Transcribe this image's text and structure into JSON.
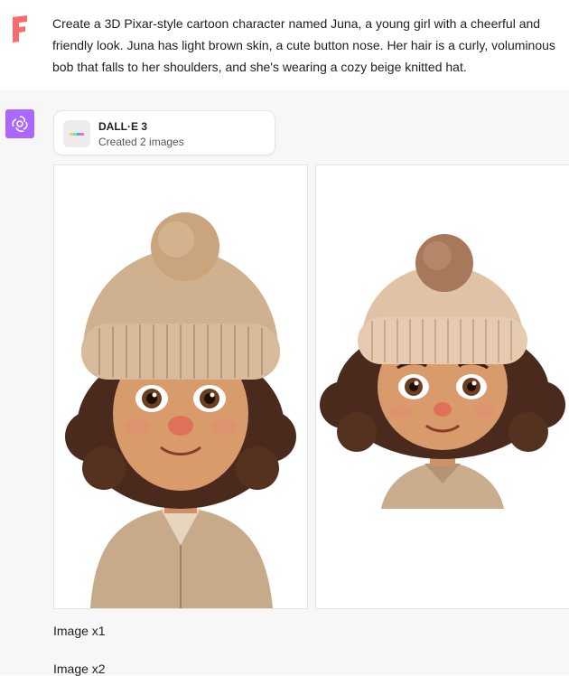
{
  "user": {
    "message": "Create a 3D Pixar-style cartoon character named Juna, a young girl with a cheerful and friendly look. Juna has light brown skin, a cute button nose. Her hair is a curly, voluminous bob that falls to her shoulders, and she's wearing a cozy beige knitted hat.",
    "avatar_icon": "brand-f-icon",
    "avatar_color": "#ff6b6b"
  },
  "assistant": {
    "avatar_icon": "openai-logo-icon",
    "avatar_color": "#ab68ff",
    "tool": {
      "name": "DALL·E 3",
      "status": "Created 2 images"
    },
    "images": [
      {
        "caption_link": "Image x1"
      },
      {
        "caption_link": "Image x2"
      }
    ]
  },
  "colors": {
    "hat": "#d4b595",
    "hair": "#4a2a1c",
    "skin": "#d99a6c",
    "nose": "#e0705a",
    "sweater": "#c9ad8c"
  }
}
